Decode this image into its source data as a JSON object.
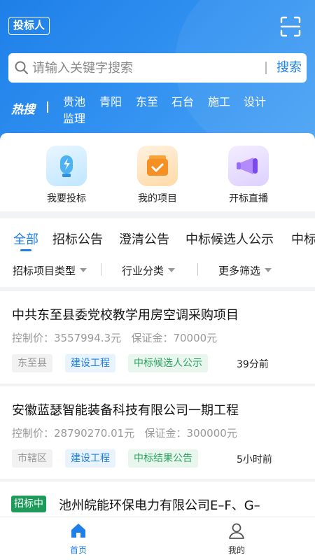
{
  "header": {
    "logo": "投标人"
  },
  "search": {
    "placeholder": "请输入关键字搜索",
    "button": "搜索"
  },
  "hot": {
    "label": "热搜",
    "tags": [
      "贵池",
      "青阳",
      "东至",
      "石台",
      "施工",
      "设计",
      "监理"
    ]
  },
  "quick": [
    {
      "label": "我要投标",
      "icon": "bulb-icon"
    },
    {
      "label": "我的项目",
      "icon": "briefcase-icon"
    },
    {
      "label": "开标直播",
      "icon": "megaphone-icon"
    }
  ],
  "tabs": [
    "全部",
    "招标公告",
    "澄清公告",
    "中标候选人公示",
    "中标"
  ],
  "active_tab": 0,
  "filters": [
    "招标项目类型",
    "行业分类",
    "更多筛选"
  ],
  "cards": [
    {
      "title": "中共东至县委党校教学用房空调采购项目",
      "price": "控制价：3557994.3元",
      "deposit": "保证金：70000元",
      "region": "东至县",
      "category": "建设工程",
      "status": "中标候选人公示",
      "time": "39分前"
    },
    {
      "title": "安徽蓝瑟智能装备科技有限公司一期工程",
      "price": "控制价：28790270.01元",
      "deposit": "保证金：300000元",
      "region": "市辖区",
      "category": "建设工程",
      "status": "中标结果公告",
      "time": "5小时前"
    },
    {
      "badge": "招标中",
      "title": "池州皖能环保电力有限公司E–F、G–"
    }
  ],
  "bottom_nav": [
    {
      "label": "首页",
      "icon": "home-icon",
      "active": true
    },
    {
      "label": "我的",
      "icon": "user-icon",
      "active": false
    }
  ],
  "colors": {
    "primary": "#1e7fe8",
    "status_green": "#2ca25f",
    "badge_green": "#1e9a5a",
    "muted": "#999999"
  }
}
